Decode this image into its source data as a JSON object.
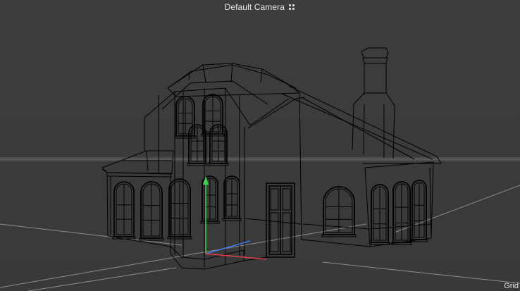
{
  "viewport": {
    "camera_label": "Default Camera",
    "grid_label": "Grid",
    "camera_icon": "camera-indicator-icon",
    "colors": {
      "background": "#3c3c3c",
      "horizon": "#5e5e5e",
      "grid_line": "#8a8a8a",
      "wireframe": "#000000",
      "axis_x": "#e0404a",
      "axis_y": "#3cd24a",
      "axis_z": "#3a78e6",
      "label_text": "#e8e8e8"
    }
  },
  "scene": {
    "object": "house-wireframe-model"
  }
}
